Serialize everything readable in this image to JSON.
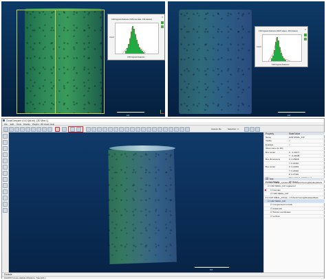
{
  "top_left": {
    "hist_title": "C2M signed distances (C2M raw data, 149 classes)",
    "hist_x_label": "C2M signed distances",
    "hist_y_label": "Count",
    "scale_label": "0.6"
  },
  "top_right": {
    "hist_title": "C2M signed distances (MKP values, 100 classes)",
    "hist_x_label": "C2M signed distances",
    "hist_y_label": "Count",
    "scale_label": "0.6"
  },
  "app": {
    "title": "CloudCompare v2.6.3 [64-bit] - [3D View 1]",
    "menu": [
      "File",
      "Edit",
      "Tools",
      "Display",
      "Plugins",
      "3D Views",
      "Help"
    ],
    "toolbar_extra": [
      "Acquire file",
      "Selection: 4"
    ],
    "viewport_scale": "0.6",
    "properties": {
      "header": [
        "Property",
        "State/Value"
      ],
      "rows": [
        [
          "Name",
          "C2M SIMAL_ICP"
        ],
        [
          "Visible",
          "✓"
        ],
        [
          "Enabled",
          "✓"
        ],
        [
          "Show name (in 3D)",
          ""
        ],
        [
          "Box center",
          "X: -1.21077"
        ],
        [
          "",
          "Y: -0.23008"
        ],
        [
          "Box dimensions",
          "X: 0.25008"
        ],
        [
          "",
          "Y: 0.24391"
        ],
        [
          "Box center",
          "X: 0.24391"
        ],
        [
          "",
          "Y: 0.24991"
        ],
        [
          "",
          "Z: 0.27391"
        ],
        [
          "Info",
          "Object ID: 7 - Children: 4"
        ],
        [
          "Current Display",
          "3D View 1"
        ]
      ],
      "db_tree_header": "DB Tree",
      "db_tree": [
        "C:\\ICP SIMAL_cylinder.ply - C:\\Users\\Yucong\\Desktop\\Rock",
        "C2M SIMAL_ICP registered",
        "Normals",
        "C2M SIMAL_ICP",
        "C:\\ICP SIMAL_ICP.ply - C:\\Users\\Yucong\\Desktop\\Rock",
        "C2M SIMAL_ICP",
        "Compressed normals",
        "scalarvals",
        "Texture coordinates",
        "vertices"
      ]
    },
    "console_label": "Console",
    "status": "[14:08:57] Cross-validation/Distance: Total (18) s"
  },
  "colors": {
    "viewport_bg": "#0a2d56",
    "highlight": "#e02020",
    "hist_bars": "#22aa44"
  }
}
